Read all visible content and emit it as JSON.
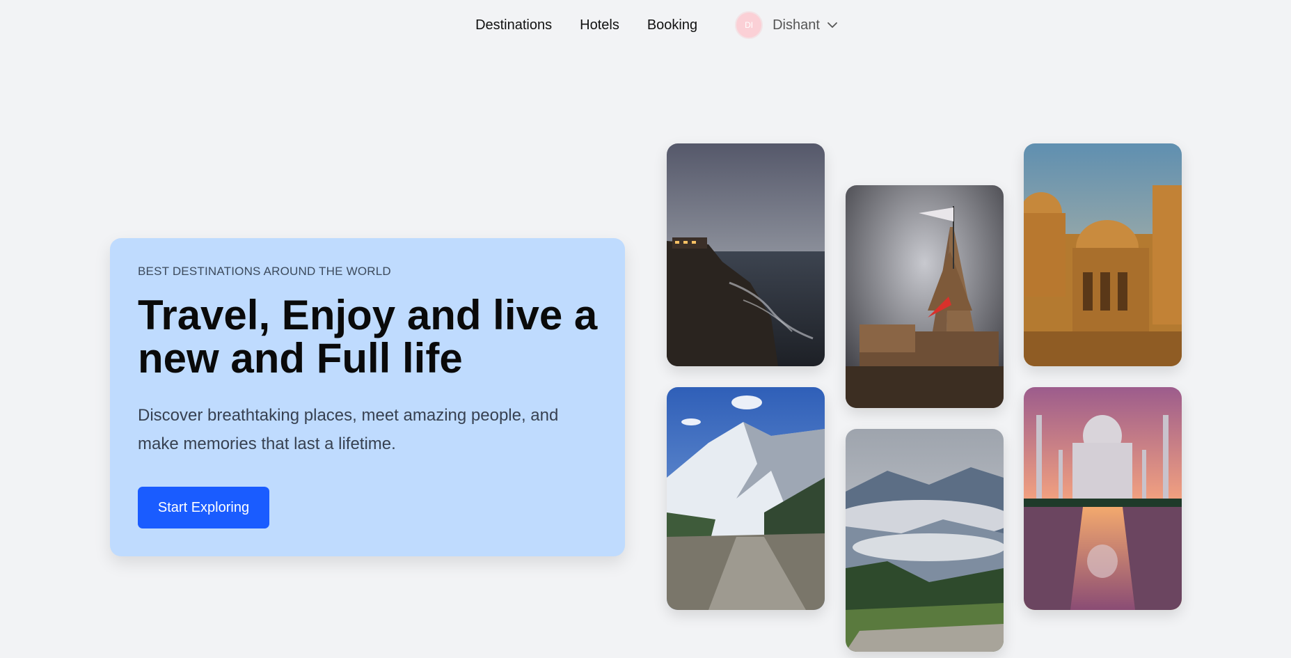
{
  "nav": {
    "links": [
      "Destinations",
      "Hotels",
      "Booking"
    ],
    "user": {
      "initials": "DI",
      "name": "Dishant"
    }
  },
  "hero": {
    "eyebrow": "BEST DESTINATIONS AROUND THE WORLD",
    "headline": "Travel, Enjoy and live a new and Full life",
    "subtext": "Discover breathtaking places, meet amazing people, and make memories that last a lifetime.",
    "cta_label": "Start Exploring"
  },
  "colors": {
    "background": "#f2f3f5",
    "hero_card": "#bfdbfe",
    "cta": "#1a5cff",
    "avatar": "#fbd0d6"
  },
  "gallery": [
    {
      "subject": "coastal cliff at dusk"
    },
    {
      "subject": "temple with flags under stormy sky"
    },
    {
      "subject": "golden sandstone cenotaphs"
    },
    {
      "subject": "snowy mountain road"
    },
    {
      "subject": "misty mountain valley"
    },
    {
      "subject": "taj mahal at sunset"
    }
  ]
}
